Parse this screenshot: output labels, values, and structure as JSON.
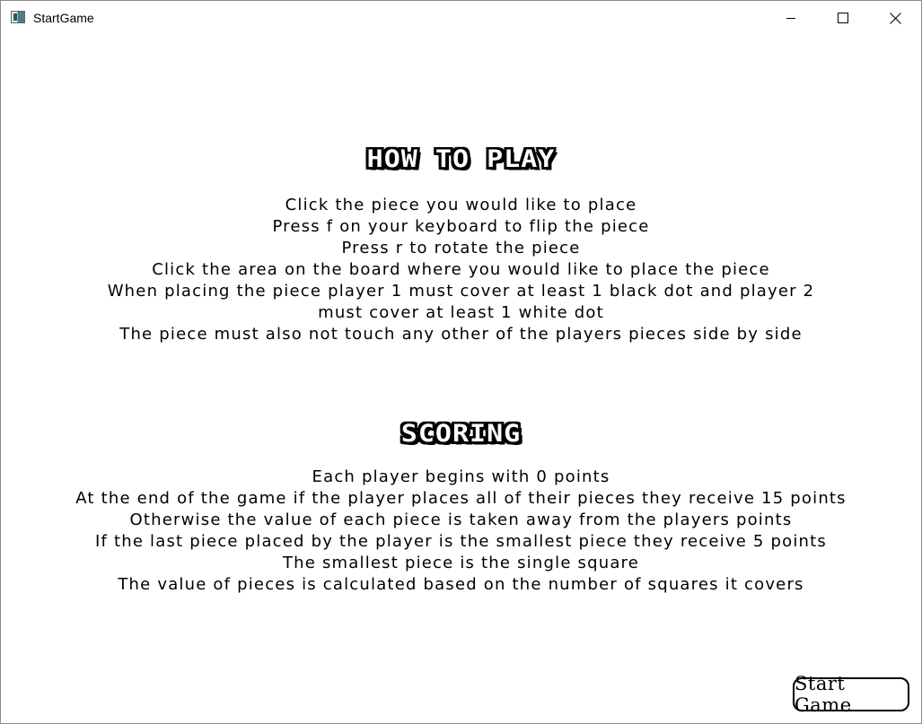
{
  "window": {
    "title": "StartGame",
    "controls": {
      "minimize_icon": "minimize-icon",
      "maximize_icon": "maximize-icon",
      "close_icon": "close-icon"
    }
  },
  "how_to_play": {
    "heading": "HOW TO PLAY",
    "lines": [
      "Click the piece you would like to place",
      "Press f on your keyboard to flip the piece",
      "Press r to rotate the piece",
      "Click the area on the board where you would like to place the piece",
      "When placing the piece player 1 must cover at least 1 black dot and player 2",
      "must cover at least 1 white dot",
      "The piece must also not touch any other of the players pieces side by side"
    ]
  },
  "scoring": {
    "heading": "SCORING",
    "lines": [
      "Each player begins with 0 points",
      "At the end of the game if the player places all of their pieces they receive 15 points",
      "Otherwise the value of each piece is taken away from the players points",
      "If the last piece placed by the player is the smallest piece they receive 5 points",
      "The smallest piece is the single square",
      "The value of pieces is calculated based on the number of squares it covers"
    ]
  },
  "actions": {
    "start_label": "Start Game"
  }
}
